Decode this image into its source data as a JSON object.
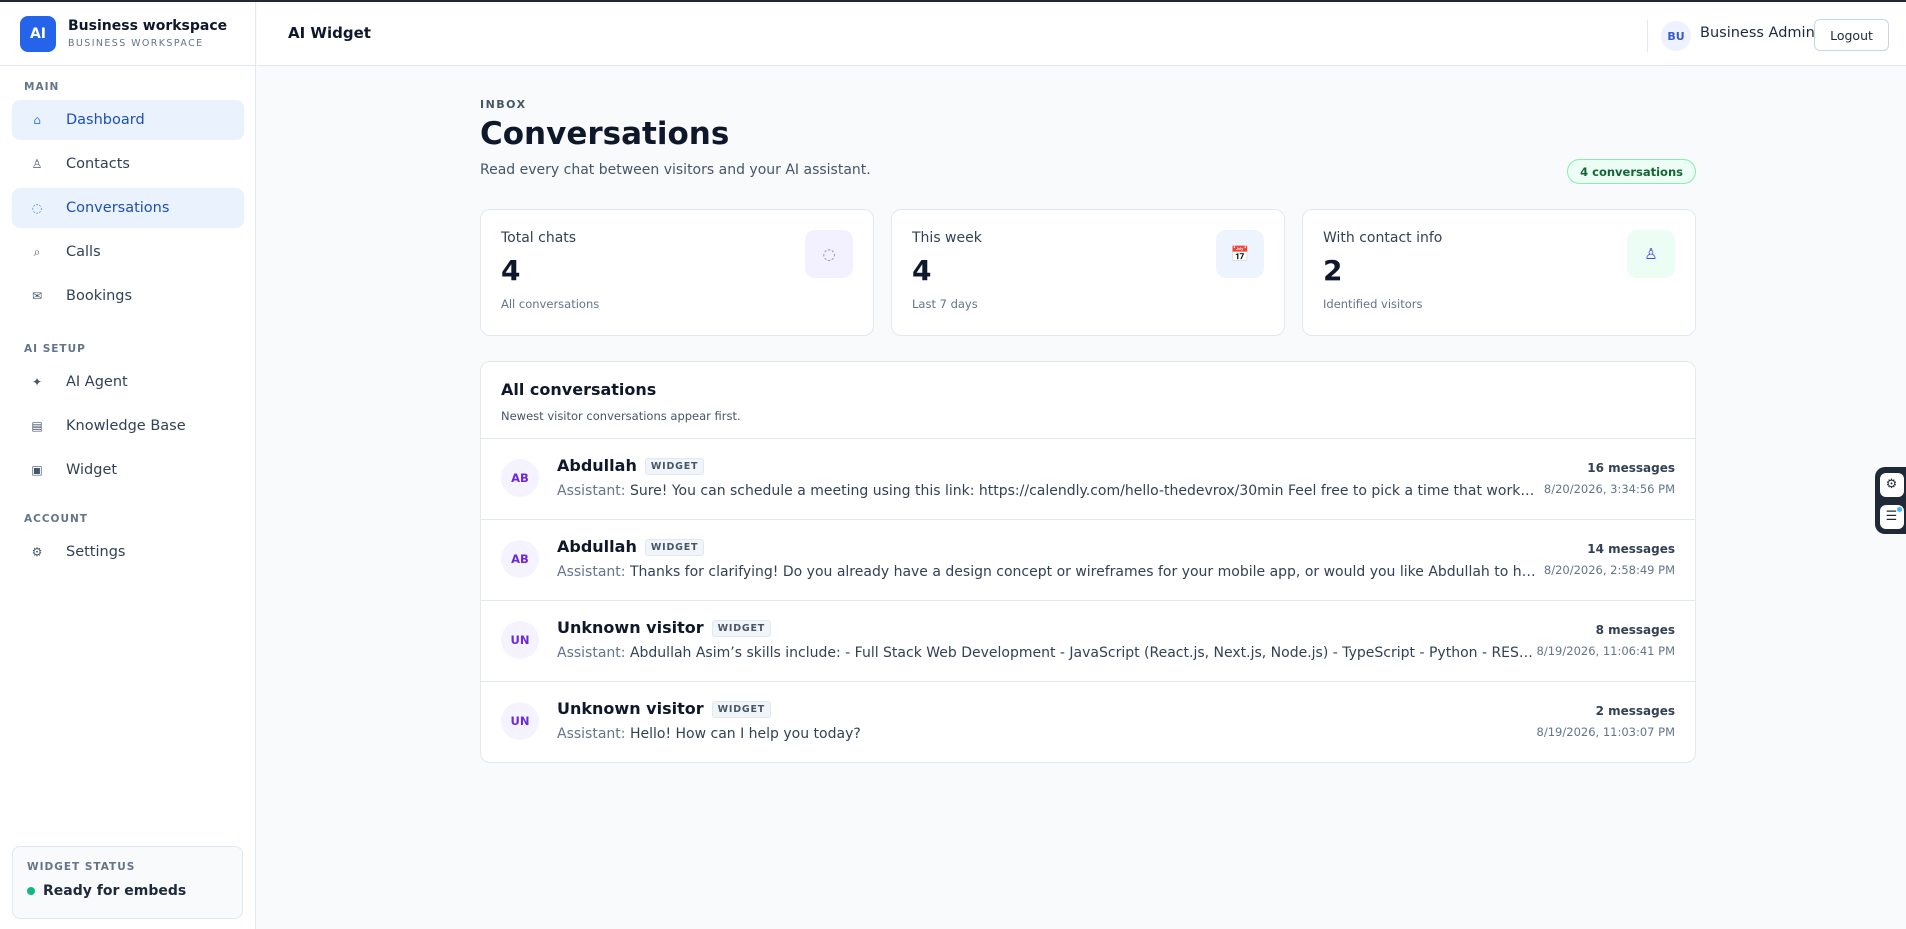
{
  "brand": {
    "logo": "AI",
    "name": "Business workspace",
    "subtitle": "BUSINESS WORKSPACE"
  },
  "sidebar": {
    "sections": [
      {
        "label": "MAIN",
        "items": [
          {
            "label": "Dashboard",
            "icon": "⌂",
            "icon_name": "home-icon",
            "active": true
          },
          {
            "label": "Contacts",
            "icon": "♙",
            "icon_name": "user-icon",
            "active": false
          },
          {
            "label": "Conversations",
            "icon": "◌",
            "icon_name": "chat-icon",
            "active": true
          },
          {
            "label": "Calls",
            "icon": "⌕",
            "icon_name": "phone-icon",
            "active": false
          },
          {
            "label": "Bookings",
            "icon": "✉",
            "icon_name": "calendar-icon",
            "active": false
          }
        ]
      },
      {
        "label": "AI SETUP",
        "items": [
          {
            "label": "AI Agent",
            "icon": "✦",
            "icon_name": "sparkle-icon",
            "active": false
          },
          {
            "label": "Knowledge Base",
            "icon": "▤",
            "icon_name": "book-icon",
            "active": false
          },
          {
            "label": "Widget",
            "icon": "▣",
            "icon_name": "widget-icon",
            "active": false
          }
        ]
      },
      {
        "label": "ACCOUNT",
        "items": [
          {
            "label": "Settings",
            "icon": "⚙",
            "icon_name": "gear-icon",
            "active": false
          }
        ]
      }
    ],
    "widget_status": {
      "label": "WIDGET STATUS",
      "value": "Ready for embeds",
      "color": "#10b981"
    }
  },
  "topbar": {
    "title": "AI Widget",
    "user_initials": "BU",
    "user_name": "Business Admin",
    "logout_label": "Logout"
  },
  "page": {
    "eyebrow": "INBOX",
    "title": "Conversations",
    "subtitle": "Read every chat between visitors and your AI assistant.",
    "count_pill": "4 conversations"
  },
  "stats": [
    {
      "label": "Total chats",
      "value": "4",
      "foot": "All conversations",
      "icon": "◌",
      "icon_name": "chat-icon",
      "tone": "purple"
    },
    {
      "label": "This week",
      "value": "4",
      "foot": "Last 7 days",
      "icon": "📅",
      "icon_name": "calendar-icon",
      "tone": "blue"
    },
    {
      "label": "With contact info",
      "value": "2",
      "foot": "Identified visitors",
      "icon": "♙",
      "icon_name": "user-icon",
      "tone": "green"
    }
  ],
  "conversations": {
    "title": "All conversations",
    "subtitle": "Newest visitor conversations appear first.",
    "rows": [
      {
        "initials": "AB",
        "name": "Abdullah",
        "badge": "WIDGET",
        "role": "Assistant:",
        "preview": "Sure! You can schedule a meeting using this link: https://calendly.com/hello-thedevrox/30min Feel free to pick a time that works best for you. If you have any questions before the meeting, let me know!",
        "count": "16 messages",
        "time": "8/20/2026, 3:34:56 PM"
      },
      {
        "initials": "AB",
        "name": "Abdullah",
        "badge": "WIDGET",
        "role": "Assistant:",
        "preview": "Thanks for clarifying! Do you already have a design concept or wireframes for your mobile app, or would you like Abdullah to handle the UX design as well?",
        "count": "14 messages",
        "time": "8/20/2026, 2:58:49 PM"
      },
      {
        "initials": "UN",
        "name": "Unknown visitor",
        "badge": "WIDGET",
        "role": "Assistant:",
        "preview": "Abdullah Asim’s skills include: - Full Stack Web Development - JavaScript (React.js, Next.js, Node.js) - TypeScript - Python - REST APIs - MongoDB - PostgreSQL",
        "count": "8 messages",
        "time": "8/19/2026, 11:06:41 PM"
      },
      {
        "initials": "UN",
        "name": "Unknown visitor",
        "badge": "WIDGET",
        "role": "Assistant:",
        "preview": "Hello! How can I help you today?",
        "count": "2 messages",
        "time": "8/19/2026, 11:03:07 PM"
      }
    ]
  },
  "floating_widget": {
    "buttons": [
      {
        "icon": "⚙",
        "icon_name": "gear-icon"
      },
      {
        "icon": "☰",
        "icon_name": "menu-icon"
      }
    ]
  }
}
